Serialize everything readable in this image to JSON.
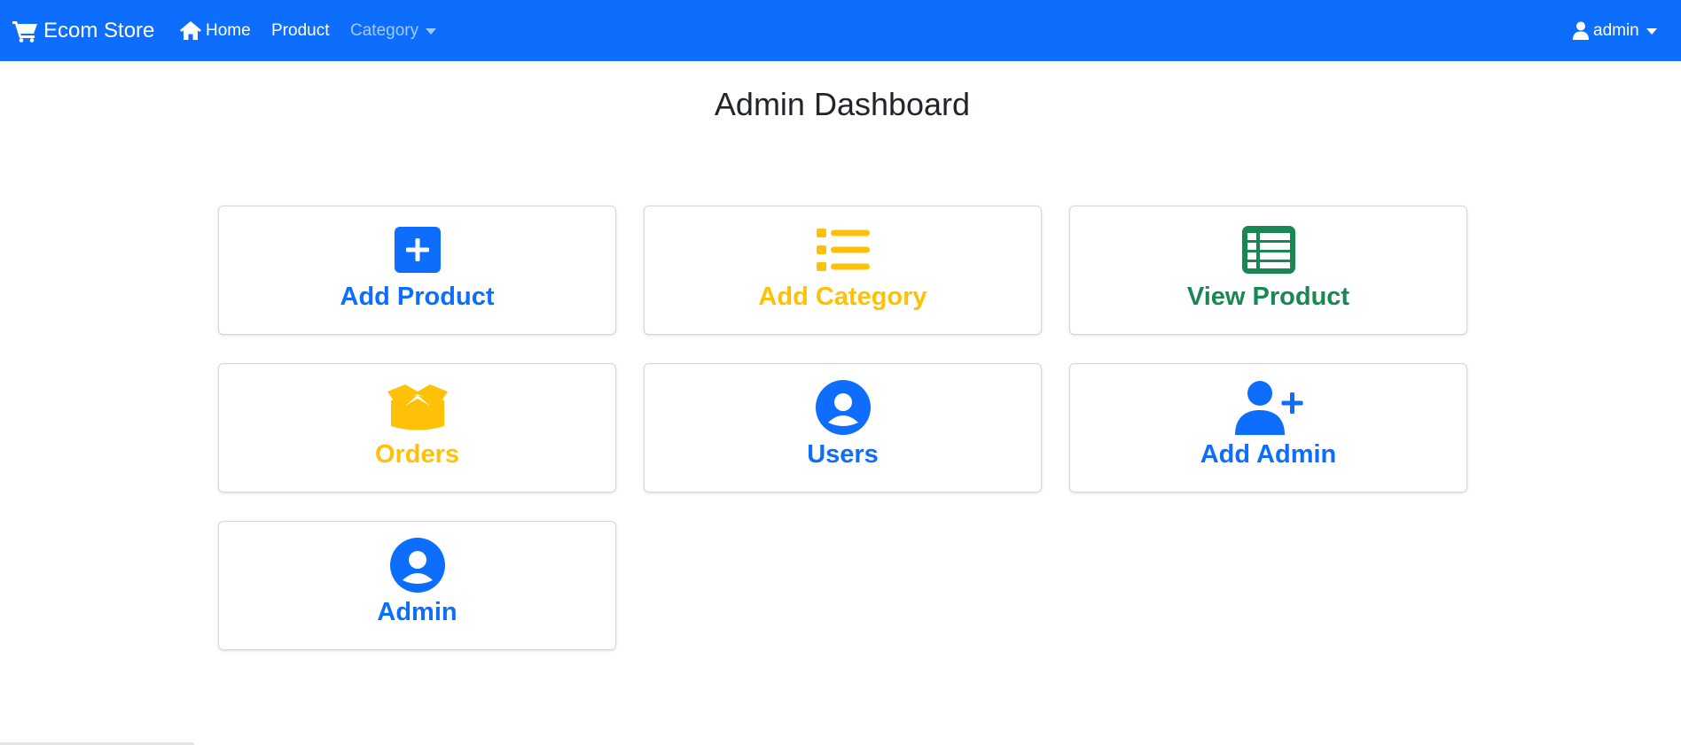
{
  "navbar": {
    "brand": "Ecom Store",
    "links": {
      "home": "Home",
      "product": "Product",
      "category": "Category"
    },
    "user": "admin"
  },
  "page": {
    "title": "Admin Dashboard"
  },
  "cards": {
    "add_product": "Add Product",
    "add_category": "Add Category",
    "view_product": "View Product",
    "orders": "Orders",
    "users": "Users",
    "add_admin": "Add Admin",
    "admin": "Admin"
  },
  "icons": {
    "brand": "cart-icon",
    "home": "home-icon",
    "user": "user-icon",
    "add_product": "plus-square-icon",
    "add_category": "list-icon",
    "view_product": "table-list-icon",
    "orders": "open-box-icon",
    "users": "user-circle-icon",
    "add_admin": "user-plus-icon",
    "admin": "user-circle-icon"
  },
  "colors": {
    "primary": "#0d6efd",
    "warning": "#ffc107",
    "success": "#198754",
    "text": "#212529"
  }
}
